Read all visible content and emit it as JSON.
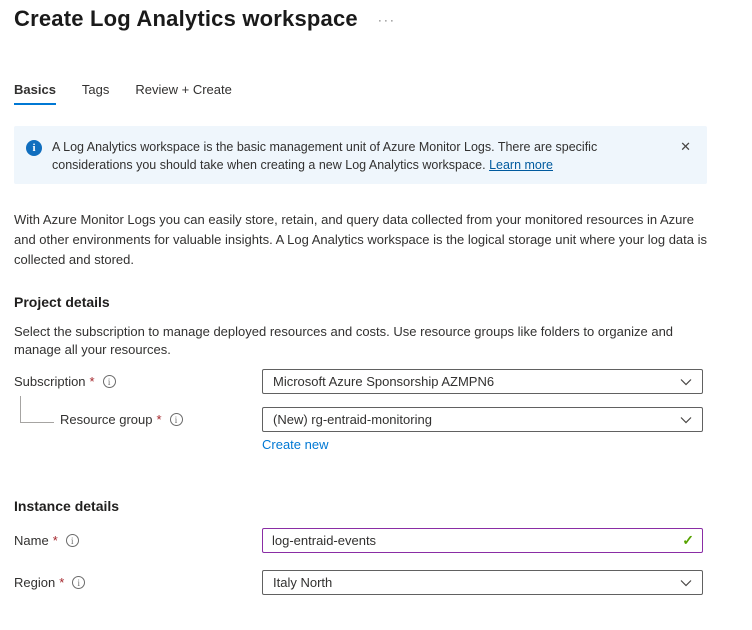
{
  "header": {
    "title": "Create Log Analytics workspace"
  },
  "icons": {
    "more": "···",
    "close": "✕",
    "info_badge": "i",
    "field_hint": "i",
    "valid_check": "✓"
  },
  "tabs": [
    {
      "label": "Basics",
      "active": true
    },
    {
      "label": "Tags",
      "active": false
    },
    {
      "label": "Review + Create",
      "active": false
    }
  ],
  "banner": {
    "text": "A Log Analytics workspace is the basic management unit of Azure Monitor Logs. There are specific considerations you should take when creating a new Log Analytics workspace. ",
    "link_label": "Learn more"
  },
  "intro": "With Azure Monitor Logs you can easily store, retain, and query data collected from your monitored resources in Azure and other environments for valuable insights. A Log Analytics workspace is the logical storage unit where your log data is collected and stored.",
  "project_details": {
    "heading": "Project details",
    "description": "Select the subscription to manage deployed resources and costs. Use resource groups like folders to organize and manage all your resources.",
    "subscription": {
      "label": "Subscription",
      "required_mark": "*",
      "value": "Microsoft Azure Sponsorship AZMPN6"
    },
    "resource_group": {
      "label": "Resource group",
      "required_mark": "*",
      "value": "(New) rg-entraid-monitoring",
      "create_new_label": "Create new"
    }
  },
  "instance_details": {
    "heading": "Instance details",
    "name": {
      "label": "Name",
      "required_mark": "*",
      "value": "log-entraid-events"
    },
    "region": {
      "label": "Region",
      "required_mark": "*",
      "value": "Italy North"
    }
  },
  "colors": {
    "accent_blue": "#0078d4",
    "banner_background": "#eff6fc",
    "info_badge_blue": "#106ebe",
    "required_red": "#a4262c",
    "valid_green": "#57a300",
    "focused_input_border": "#8a2da5",
    "input_border": "#616161"
  }
}
